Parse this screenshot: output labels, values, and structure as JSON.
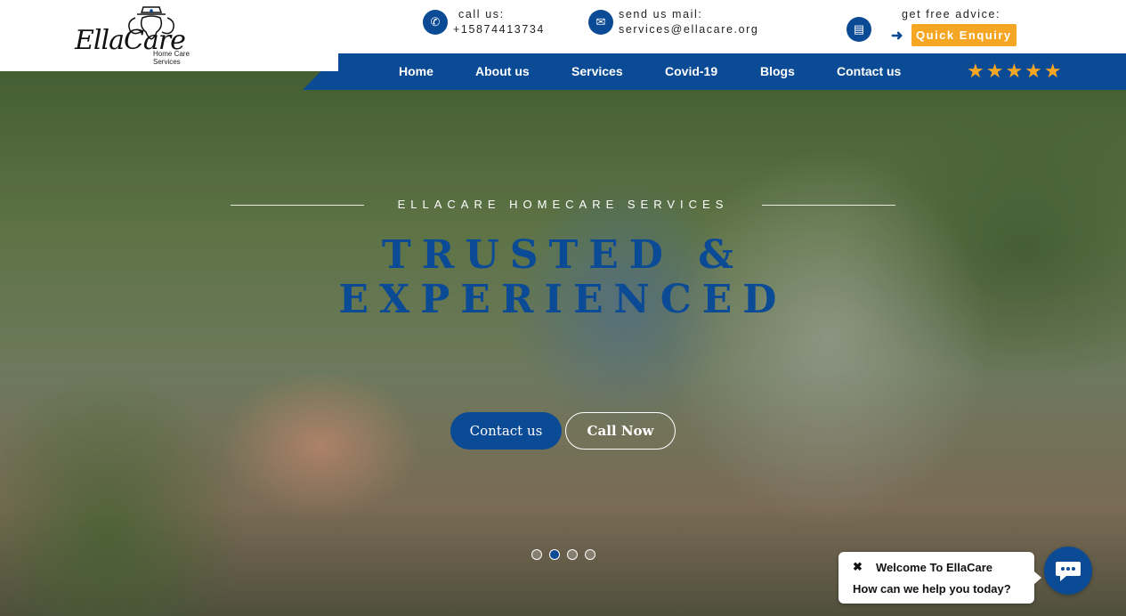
{
  "brand": {
    "name": "EllaCare",
    "tagline": "Home Care Services"
  },
  "contacts": {
    "call": {
      "label": "call us:",
      "value": "+15874413734"
    },
    "mail": {
      "label": "send us mail:",
      "value": "services@ellacare.org"
    },
    "advice": {
      "label": "get free advice:",
      "button": "Quick Enquiry"
    }
  },
  "nav": {
    "items": [
      "Home",
      "About us",
      "Services",
      "Covid-19",
      "Blogs",
      "Contact us"
    ],
    "rating_stars": "★★★★★"
  },
  "hero": {
    "kicker": "ELLACARE HOMECARE SERVICES",
    "headline_line1": "TRUSTED &",
    "headline_line2": "EXPERIENCED",
    "primary_button": "Contact us",
    "secondary_button": "Call Now",
    "slide_count": 4,
    "active_slide": 2
  },
  "chat": {
    "close": "✖",
    "title": "Welcome To EllaCare",
    "message": "How can we help you today?"
  },
  "colors": {
    "primary": "#0b4a95",
    "accent": "#f5a623"
  },
  "icons": {
    "call": "phone-icon",
    "mail": "mail-icon",
    "advice": "chat-icon",
    "enquiry_arrow": "arrow-right-icon",
    "chat_launcher": "chat-bubble-icon"
  }
}
